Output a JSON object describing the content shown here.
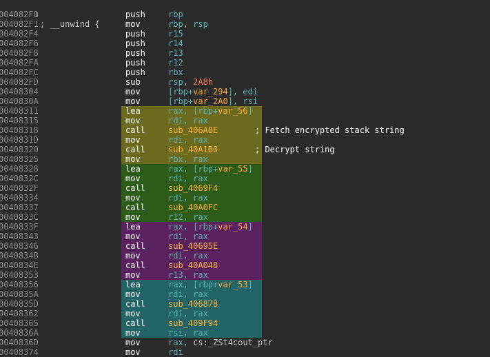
{
  "header": {
    "address": "004082F0",
    "text": "; __unwind {"
  },
  "rows": [
    {
      "addr": "004082F1",
      "mn": "push",
      "op": [
        {
          "t": "rbp",
          "c": "reg"
        }
      ]
    },
    {
      "addr": "004082F1",
      "mn": "mov",
      "op": [
        {
          "t": "rbp",
          "c": "reg"
        },
        {
          "t": ", ",
          "c": "sym"
        },
        {
          "t": "rsp",
          "c": "reg"
        }
      ]
    },
    {
      "addr": "004082F4",
      "mn": "push",
      "op": [
        {
          "t": "r15",
          "c": "reg"
        }
      ]
    },
    {
      "addr": "004082F6",
      "mn": "push",
      "op": [
        {
          "t": "r14",
          "c": "reg"
        }
      ]
    },
    {
      "addr": "004082F8",
      "mn": "push",
      "op": [
        {
          "t": "r13",
          "c": "reg"
        }
      ]
    },
    {
      "addr": "004082FA",
      "mn": "push",
      "op": [
        {
          "t": "r12",
          "c": "reg"
        }
      ]
    },
    {
      "addr": "004082FC",
      "mn": "push",
      "op": [
        {
          "t": "rbx",
          "c": "reg"
        }
      ]
    },
    {
      "addr": "004082FD",
      "mn": "sub",
      "op": [
        {
          "t": "rsp",
          "c": "reg"
        },
        {
          "t": ", ",
          "c": "sym"
        },
        {
          "t": "2A8h",
          "c": "num"
        }
      ]
    },
    {
      "addr": "00408304",
      "mn": "mov",
      "op": [
        {
          "t": "[rbp+",
          "c": "reg"
        },
        {
          "t": "var_294",
          "c": "var"
        },
        {
          "t": "], ",
          "c": "reg"
        },
        {
          "t": "edi",
          "c": "reg"
        }
      ]
    },
    {
      "addr": "0040830A",
      "mn": "mov",
      "op": [
        {
          "t": "[rbp+",
          "c": "reg"
        },
        {
          "t": "var_2A0",
          "c": "var"
        },
        {
          "t": "], ",
          "c": "reg"
        },
        {
          "t": "rsi",
          "c": "reg"
        }
      ]
    },
    {
      "addr": "00408311",
      "mn": "lea",
      "hl": "olive",
      "op": [
        {
          "t": "rax, [rbp+",
          "c": "reg"
        },
        {
          "t": "var_56",
          "c": "var"
        },
        {
          "t": "]",
          "c": "reg"
        }
      ]
    },
    {
      "addr": "00408315",
      "mn": "mov",
      "hl": "olive",
      "op": [
        {
          "t": "rdi, rax",
          "c": "reg"
        }
      ]
    },
    {
      "addr": "00408318",
      "mn": "call",
      "hl": "olive",
      "op": [
        {
          "t": "sub_406A8E",
          "c": "sub"
        }
      ],
      "comment": "; Fetch encrypted stack string"
    },
    {
      "addr": "0040831D",
      "mn": "mov",
      "hl": "olive",
      "op": [
        {
          "t": "rdi, rax",
          "c": "reg"
        }
      ]
    },
    {
      "addr": "00408320",
      "mn": "call",
      "hl": "olive",
      "op": [
        {
          "t": "sub_40A1B0",
          "c": "sub"
        }
      ],
      "comment": "; Decrypt string"
    },
    {
      "addr": "00408325",
      "mn": "mov",
      "hl": "olive",
      "op": [
        {
          "t": "rbx, rax",
          "c": "reg"
        }
      ]
    },
    {
      "addr": "00408328",
      "mn": "lea",
      "hl": "green",
      "op": [
        {
          "t": "rax, [rbp+",
          "c": "reg"
        },
        {
          "t": "var_55",
          "c": "var"
        },
        {
          "t": "]",
          "c": "reg"
        }
      ]
    },
    {
      "addr": "0040832C",
      "mn": "mov",
      "hl": "green",
      "op": [
        {
          "t": "rdi, rax",
          "c": "reg"
        }
      ]
    },
    {
      "addr": "0040832F",
      "mn": "call",
      "hl": "green",
      "op": [
        {
          "t": "sub_4069F4",
          "c": "sub"
        }
      ]
    },
    {
      "addr": "00408334",
      "mn": "mov",
      "hl": "green",
      "op": [
        {
          "t": "rdi, rax",
          "c": "reg"
        }
      ]
    },
    {
      "addr": "00408337",
      "mn": "call",
      "hl": "green",
      "op": [
        {
          "t": "sub_40A0FC",
          "c": "sub"
        }
      ]
    },
    {
      "addr": "0040833C",
      "mn": "mov",
      "hl": "green",
      "op": [
        {
          "t": "r12, rax",
          "c": "reg"
        }
      ]
    },
    {
      "addr": "0040833F",
      "mn": "lea",
      "hl": "purple",
      "op": [
        {
          "t": "rax, [rbp+",
          "c": "reg"
        },
        {
          "t": "var_54",
          "c": "var"
        },
        {
          "t": "]",
          "c": "reg"
        }
      ]
    },
    {
      "addr": "00408343",
      "mn": "mov",
      "hl": "purple",
      "op": [
        {
          "t": "rdi, rax",
          "c": "reg"
        }
      ]
    },
    {
      "addr": "00408346",
      "mn": "call",
      "hl": "purple",
      "op": [
        {
          "t": "sub_40695E",
          "c": "sub"
        }
      ]
    },
    {
      "addr": "0040834B",
      "mn": "mov",
      "hl": "purple",
      "op": [
        {
          "t": "rdi, rax",
          "c": "reg"
        }
      ]
    },
    {
      "addr": "0040834E",
      "mn": "call",
      "hl": "purple",
      "op": [
        {
          "t": "sub_40A048",
          "c": "sub"
        }
      ]
    },
    {
      "addr": "00408353",
      "mn": "mov",
      "hl": "purple",
      "op": [
        {
          "t": "r13, rax",
          "c": "reg"
        }
      ]
    },
    {
      "addr": "00408356",
      "mn": "lea",
      "hl": "teal",
      "op": [
        {
          "t": "rax, [rbp+",
          "c": "reg"
        },
        {
          "t": "var_53",
          "c": "var"
        },
        {
          "t": "]",
          "c": "reg"
        }
      ]
    },
    {
      "addr": "0040835A",
      "mn": "mov",
      "hl": "teal",
      "op": [
        {
          "t": "rdi, rax",
          "c": "reg"
        }
      ]
    },
    {
      "addr": "0040835D",
      "mn": "call",
      "hl": "teal",
      "op": [
        {
          "t": "sub_406878",
          "c": "sub"
        }
      ]
    },
    {
      "addr": "00408362",
      "mn": "mov",
      "hl": "teal",
      "op": [
        {
          "t": "rdi, rax",
          "c": "reg"
        }
      ]
    },
    {
      "addr": "00408365",
      "mn": "call",
      "hl": "teal",
      "op": [
        {
          "t": "sub_409F94",
          "c": "sub"
        }
      ]
    },
    {
      "addr": "0040836A",
      "mn": "mov",
      "hl": "teal",
      "op": [
        {
          "t": "rsi, rax",
          "c": "reg"
        }
      ]
    },
    {
      "addr": "0040836D",
      "mn": "mov",
      "op": [
        {
          "t": "rax, ",
          "c": "reg"
        },
        {
          "t": "cs:_ZSt4cout_ptr",
          "c": "sym"
        }
      ]
    },
    {
      "addr": "00408374",
      "mn": "mov",
      "op": [
        {
          "t": "rdi",
          "c": "reg"
        }
      ]
    }
  ]
}
